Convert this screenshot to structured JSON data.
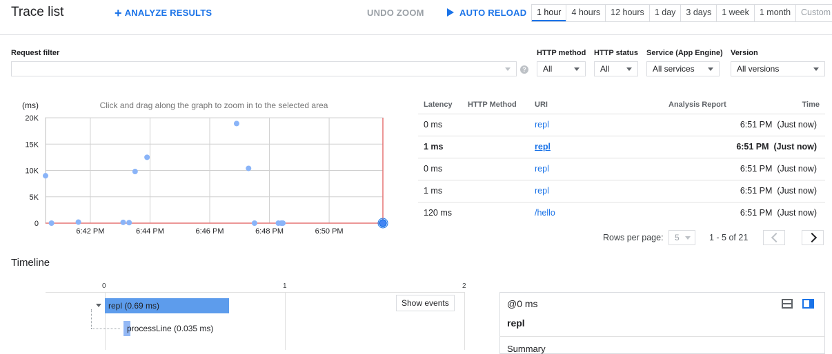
{
  "header": {
    "title": "Trace list",
    "analyze_label": "ANALYZE RESULTS",
    "undo_zoom_label": "UNDO ZOOM",
    "auto_reload_label": "AUTO RELOAD",
    "time_ranges": [
      "1 hour",
      "4 hours",
      "12 hours",
      "1 day",
      "3 days",
      "1 week",
      "1 month",
      "Custom"
    ],
    "selected_range": "1 hour"
  },
  "filters": {
    "request_filter_label": "Request filter",
    "request_filter_value": "",
    "http_method_label": "HTTP method",
    "http_method_value": "All",
    "http_status_label": "HTTP status",
    "http_status_value": "All",
    "service_label": "Service (App Engine)",
    "service_value": "All services",
    "version_label": "Version",
    "version_value": "All versions"
  },
  "chart_data": {
    "type": "scatter",
    "title": "Click and drag along the graph to zoom in to the selected area",
    "ylabel": "(ms)",
    "xlabel": "",
    "x_ticks": [
      "6:42 PM",
      "6:44 PM",
      "6:46 PM",
      "6:48 PM",
      "6:50 PM"
    ],
    "y_ticks": [
      "20K",
      "15K",
      "10K",
      "5K",
      "0"
    ],
    "ylim": [
      0,
      20000
    ],
    "xlim_minutes": [
      40.5,
      51.8
    ],
    "x_unit": "minute past 6 PM",
    "grid": true,
    "points": [
      {
        "x": 40.5,
        "y": 9000
      },
      {
        "x": 40.7,
        "y": 0
      },
      {
        "x": 41.6,
        "y": 200
      },
      {
        "x": 43.1,
        "y": 150
      },
      {
        "x": 43.3,
        "y": 100
      },
      {
        "x": 43.5,
        "y": 9800
      },
      {
        "x": 43.9,
        "y": 12500
      },
      {
        "x": 46.9,
        "y": 18900
      },
      {
        "x": 47.3,
        "y": 10400
      },
      {
        "x": 47.5,
        "y": 0
      },
      {
        "x": 48.3,
        "y": 0
      },
      {
        "x": 48.4,
        "y": 0
      },
      {
        "x": 48.45,
        "y": 0
      },
      {
        "x": 51.8,
        "y": 0
      }
    ],
    "point_color": "#8ab4f8",
    "selected_color": "#4285f4",
    "cursor_line_color": "#e57373"
  },
  "table": {
    "headers": {
      "latency": "Latency",
      "method": "HTTP Method",
      "uri": "URI",
      "report": "Analysis Report",
      "time": "Time"
    },
    "rows": [
      {
        "latency": "0 ms",
        "method": "",
        "uri": "repl",
        "time": "6:51 PM  (Just now)",
        "selected": false
      },
      {
        "latency": "1 ms",
        "method": "",
        "uri": "repl",
        "time": "6:51 PM  (Just now)",
        "selected": true
      },
      {
        "latency": "0 ms",
        "method": "",
        "uri": "repl",
        "time": "6:51 PM  (Just now)",
        "selected": false
      },
      {
        "latency": "1 ms",
        "method": "",
        "uri": "repl",
        "time": "6:51 PM  (Just now)",
        "selected": false
      },
      {
        "latency": "120 ms",
        "method": "",
        "uri": "/hello",
        "time": "6:51 PM  (Just now)",
        "selected": false
      }
    ],
    "rows_per_page_label": "Rows per page:",
    "rows_per_page_value": "5",
    "range_text": "1 - 5 of 21"
  },
  "timeline": {
    "heading": "Timeline",
    "scale": [
      "0",
      "1",
      "2"
    ],
    "spans": [
      {
        "label": "repl (0.69 ms)",
        "start_ms": 0,
        "duration_ms": 0.69
      },
      {
        "label": "processLine (0.035 ms)",
        "start_ms": 0.1,
        "duration_ms": 0.035
      }
    ],
    "show_events_label": "Show events"
  },
  "details": {
    "offset": "@0 ms",
    "name": "repl",
    "summary_label": "Summary"
  }
}
